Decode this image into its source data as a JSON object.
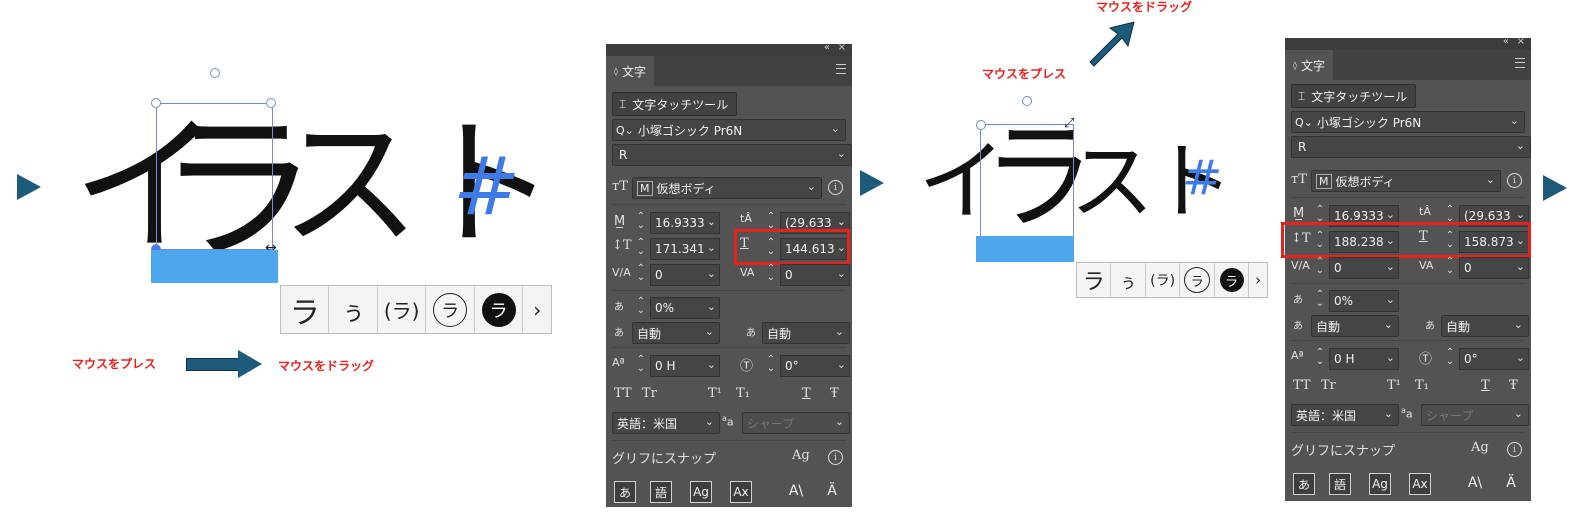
{
  "canvas": {
    "text_1": "イ",
    "text_2": "ラ",
    "text_3": "スト",
    "hash": "#",
    "glyphs": [
      "ラ",
      "ぅ",
      "(ラ)",
      "ラ",
      "ラ"
    ],
    "more_glyph": "›",
    "press_label": "マウスをプレス",
    "drag_label": "マウスをドラッグ"
  },
  "panel": {
    "tab_label": "文字",
    "collapse_icon": "«",
    "close_icon": "×",
    "touch_tool": "文字タッチツール",
    "font_family": "小塚ゴシック Pr6N",
    "font_style": "R",
    "font_size_reference": "仮想ボディ",
    "chevron": "⌄",
    "align_auto": "自動",
    "language": "英語：米国",
    "antialias": "シャープ",
    "snap_label": "グリフにスナップ",
    "aa_icon": "a",
    "bottom_icons": [
      "あ",
      "語",
      "Ag",
      "Ax",
      "A\\",
      "Ä"
    ],
    "typo_icons": [
      "TT",
      "Tr",
      "T¹",
      "T₁",
      "T",
      "Ŧ"
    ],
    "percent_value": "0%",
    "shift_value": "0 H",
    "rotation_value": "0°"
  },
  "panel_1": {
    "font_size": "16.9333",
    "leading": "(29.633",
    "vertical_scale": "171.341",
    "horizontal_scale": "144.613",
    "kerning": "0",
    "tracking": "0"
  },
  "panel_2": {
    "font_size": "16.9333",
    "leading": "(29.633",
    "vertical_scale": "188.238",
    "horizontal_scale": "158.873",
    "kerning": "0",
    "tracking": "0"
  },
  "colors": {
    "highlight": "#e8221b",
    "arrow": "#1e5a7a",
    "baseline": "#4ea6ec",
    "hash": "#3f7be6",
    "panel_bg": "#535353"
  }
}
